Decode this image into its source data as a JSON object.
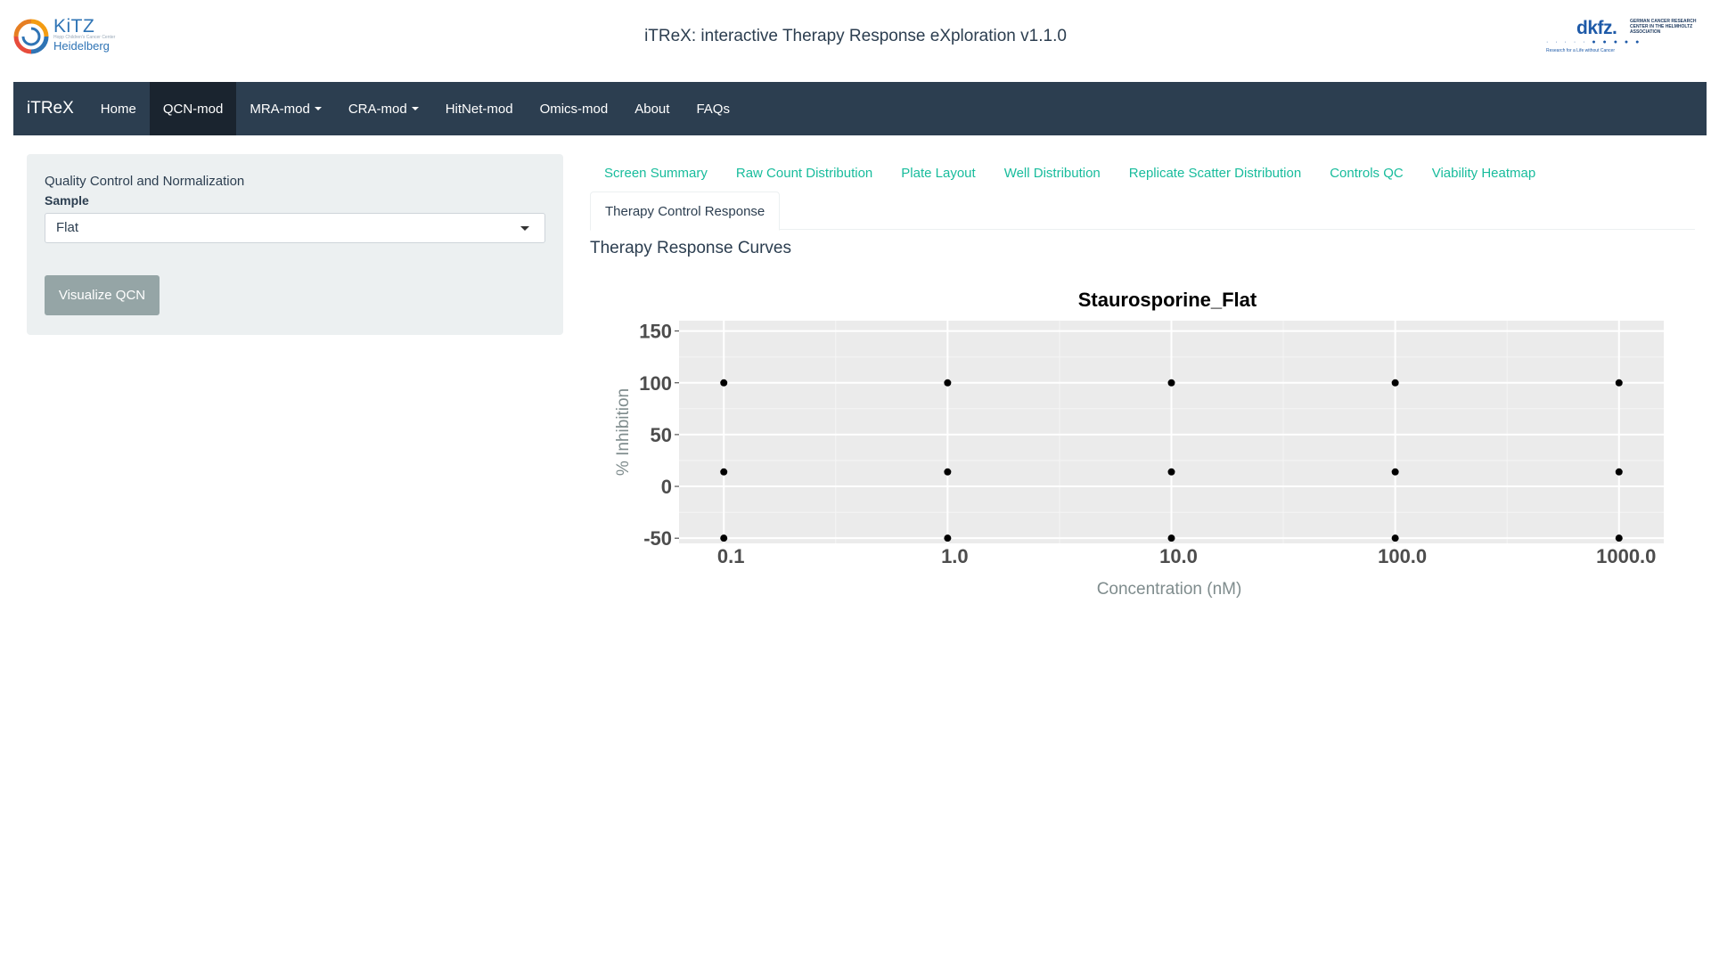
{
  "header": {
    "app_title": "iTReX: interactive Therapy Response eXploration v1.1.0",
    "left_logo": {
      "name": "KiTZ",
      "subtitle": "Hopp Children's Cancer Center",
      "city": "Heidelberg"
    },
    "right_logo": {
      "name": "dkfz.",
      "subtitle": "GERMAN CANCER RESEARCH CENTER IN THE HELMHOLTZ ASSOCIATION",
      "tagline": "Research for a Life without Cancer"
    }
  },
  "navbar": {
    "brand": "iTReX",
    "items": [
      {
        "label": "Home",
        "active": false,
        "dropdown": false
      },
      {
        "label": "QCN-mod",
        "active": true,
        "dropdown": false
      },
      {
        "label": "MRA-mod",
        "active": false,
        "dropdown": true
      },
      {
        "label": "CRA-mod",
        "active": false,
        "dropdown": true
      },
      {
        "label": "HitNet-mod",
        "active": false,
        "dropdown": false
      },
      {
        "label": "Omics-mod",
        "active": false,
        "dropdown": false
      },
      {
        "label": "About",
        "active": false,
        "dropdown": false
      },
      {
        "label": "FAQs",
        "active": false,
        "dropdown": false
      }
    ]
  },
  "sidebar": {
    "panel_title": "Quality Control and Normalization",
    "sample_label": "Sample",
    "sample_value": "Flat",
    "button_label": "Visualize QCN"
  },
  "tabs": {
    "row1": [
      "Screen Summary",
      "Raw Count Distribution",
      "Plate Layout",
      "Well Distribution",
      "Replicate Scatter Distribution",
      "Controls QC",
      "Viability Heatmap"
    ],
    "row2": [
      "Therapy Control Response"
    ],
    "active": "Therapy Control Response"
  },
  "main": {
    "section_title": "Therapy Response Curves"
  },
  "colors": {
    "navbar": "#2c3e50",
    "accent": "#18bc9c",
    "panel": "#ecf0f1",
    "plot_bg": "#ebebeb",
    "point": "#000000"
  },
  "chart_data": {
    "type": "scatter",
    "title": "Staurosporine_Flat",
    "xlabel": "Concentration (nM)",
    "ylabel": "% Inhibition",
    "x_scale": "log10",
    "x_ticks": [
      "0.1",
      "1.0",
      "10.0",
      "100.0",
      "1000.0"
    ],
    "y_ticks": [
      "150",
      "100",
      "50",
      "0",
      "-50"
    ],
    "ylim": [
      -55,
      160
    ],
    "grid": true,
    "points": [
      {
        "x": 0.1,
        "y": 100
      },
      {
        "x": 0.1,
        "y": 14
      },
      {
        "x": 0.1,
        "y": -50
      },
      {
        "x": 1.0,
        "y": 100
      },
      {
        "x": 1.0,
        "y": 14
      },
      {
        "x": 1.0,
        "y": -50
      },
      {
        "x": 10.0,
        "y": 100
      },
      {
        "x": 10.0,
        "y": 14
      },
      {
        "x": 10.0,
        "y": -50
      },
      {
        "x": 100.0,
        "y": 100
      },
      {
        "x": 100.0,
        "y": 14
      },
      {
        "x": 100.0,
        "y": -50
      },
      {
        "x": 1000.0,
        "y": 100
      },
      {
        "x": 1000.0,
        "y": 14
      },
      {
        "x": 1000.0,
        "y": -50
      }
    ]
  }
}
